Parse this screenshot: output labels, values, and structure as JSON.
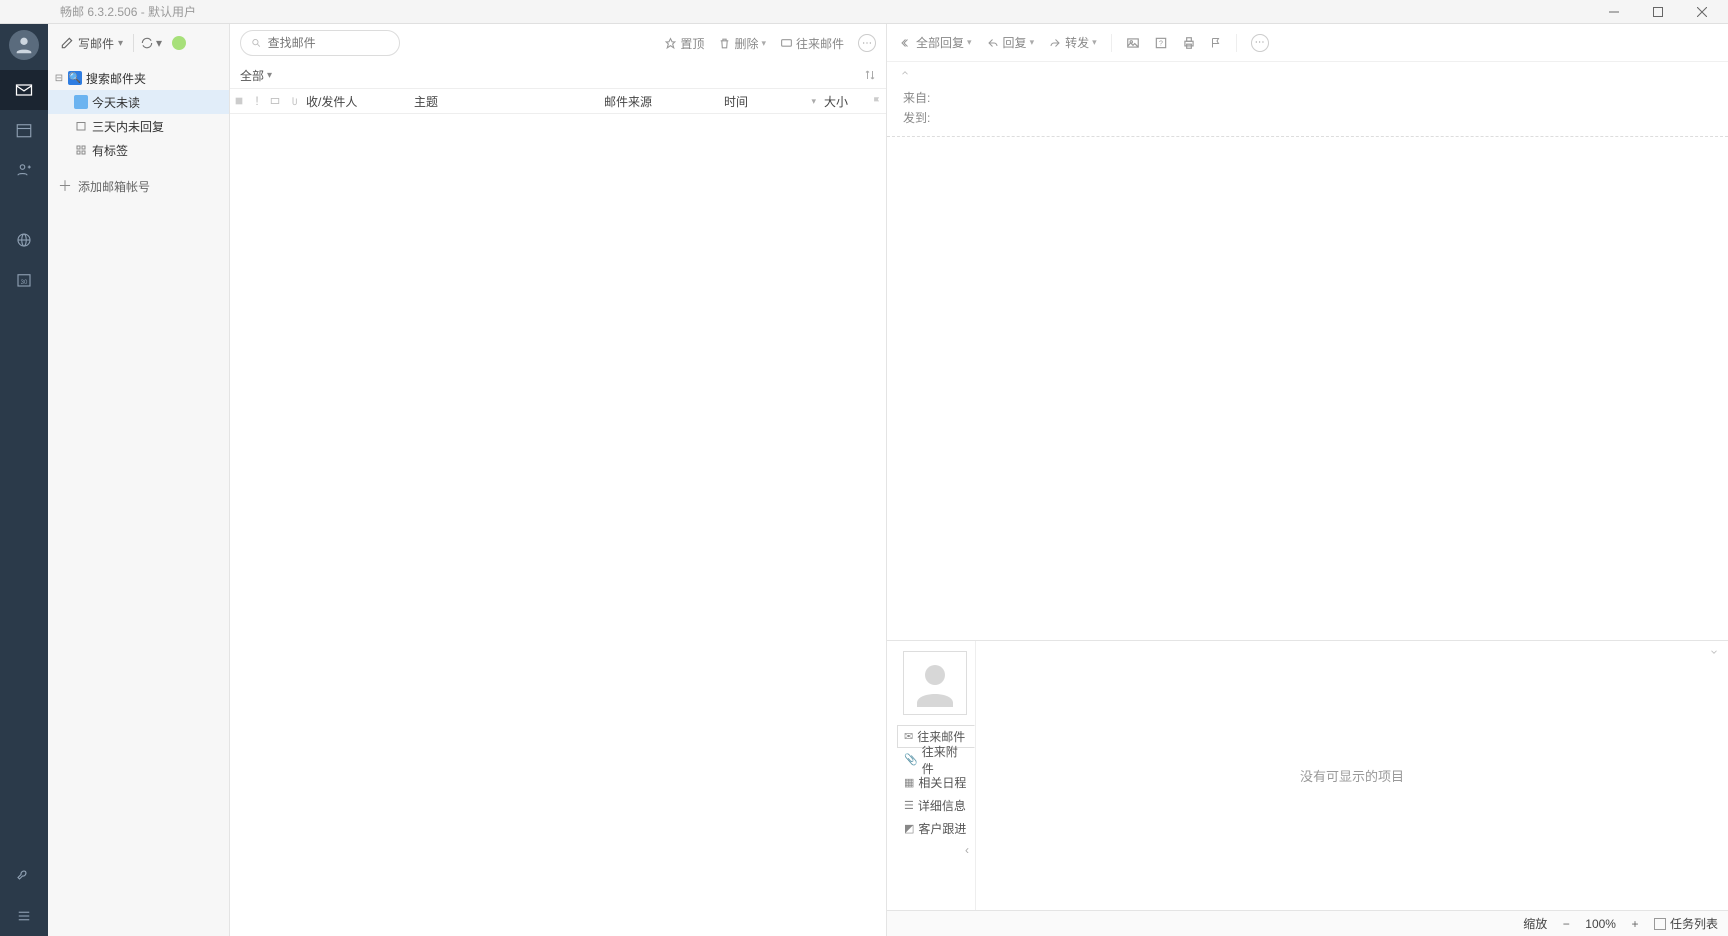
{
  "titlebar": {
    "title": "畅邮 6.3.2.506  -  默认用户"
  },
  "sidebar": {
    "compose_label": "写邮件",
    "tree_root": "搜索邮件夹",
    "items": [
      "今天未读",
      "三天内未回复",
      "有标签"
    ],
    "add_account": "添加邮箱帐号"
  },
  "listpane": {
    "search_placeholder": "查找邮件",
    "actions": {
      "pin": "置顶",
      "delete": "删除",
      "conv": "往来邮件"
    },
    "filter_all": "全部",
    "headers": {
      "sender": "收/发件人",
      "subject": "主题",
      "source": "邮件来源",
      "time": "时间",
      "size": "大小"
    }
  },
  "readpane": {
    "actions": {
      "reply_all": "全部回复",
      "reply": "回复",
      "forward": "转发"
    },
    "from_label": "来自:",
    "to_label": "发到:",
    "contact_tabs": [
      "往来邮件",
      "往来附件",
      "相关日程",
      "详细信息",
      "客户跟进"
    ],
    "empty_text": "没有可显示的项目"
  },
  "statusbar": {
    "zoom_label": "缩放",
    "zoom_value": "100%",
    "tasklist": "任务列表"
  }
}
